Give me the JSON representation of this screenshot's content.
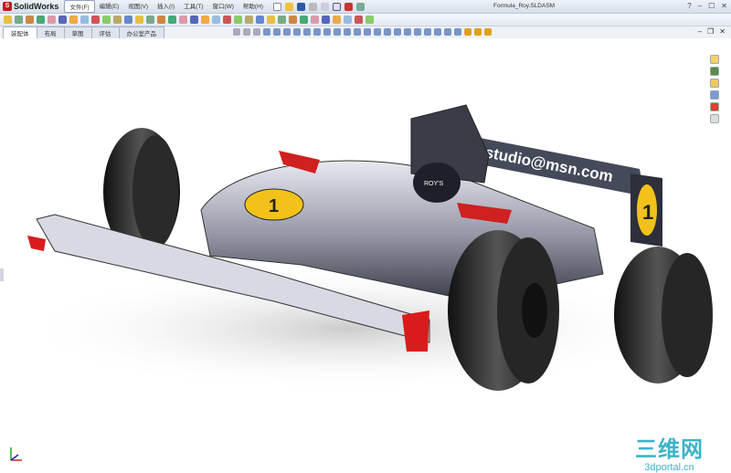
{
  "app": {
    "name": "SolidWorks",
    "document_title": "Formula_Roy.SLDASM"
  },
  "menu": [
    "文件(F)",
    "编辑(E)",
    "视图(V)",
    "插入(I)",
    "工具(T)",
    "窗口(W)",
    "帮助(H)"
  ],
  "window_controls": {
    "help": "?",
    "minimize": "–",
    "maximize": "☐",
    "close": "✕"
  },
  "tabs": [
    "装配体",
    "布局",
    "草图",
    "评估",
    "办公室产品"
  ],
  "active_tab": "装配体",
  "doc_controls": {
    "minimize": "–",
    "restore": "❐",
    "close": "✕"
  },
  "model": {
    "wing_text": "studio@msn.com",
    "headrest_text": "ROY'S",
    "number": "1"
  },
  "watermark": {
    "line1": "三维网",
    "line2": "3dportal.cn"
  },
  "colors": {
    "accent": "#c8161d",
    "body": "#8a8e9c",
    "tire": "#222",
    "number_plate": "#f2c21a"
  }
}
